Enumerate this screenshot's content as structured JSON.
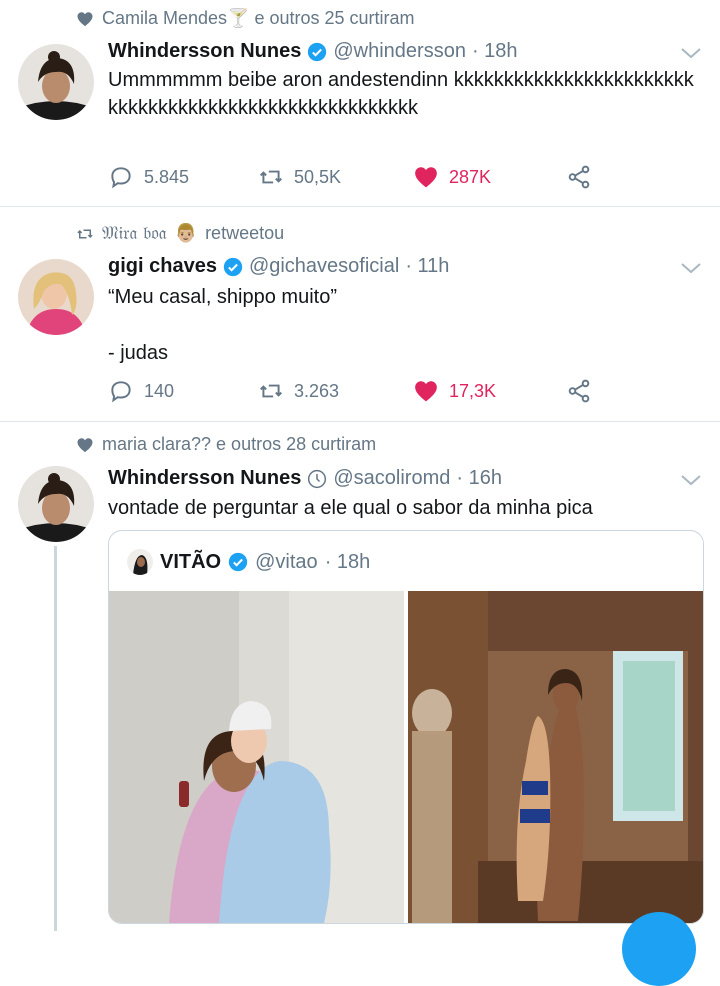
{
  "tweets": [
    {
      "context": "Camila Mendes🍸 e outros 25 curtiram",
      "name": "Whindersson Nunes",
      "handle": "@whindersson",
      "time": "· 18h",
      "text": "Ummmmmm beibe aron andestendinn kkkkkkkkkkkkkkkkkkkkkkkkkkkkkkkkkkkkkkkkkkkkkkkkkkkkkkk",
      "replies": "5.845",
      "retweets": "50,5K",
      "likes": "287K"
    },
    {
      "context_name": "𝔐𝔦𝔯𝔞 𝔟𝔬𝔞",
      "context_emoji": "👨🏼",
      "context_suffix": "retweetou",
      "name": "gigi chaves",
      "handle": "@gichavesoficial",
      "time": "· 11h",
      "text": "“Meu casal, shippo muito”\n\n- judas",
      "replies": "140",
      "retweets": "3.263",
      "likes": "17,3K"
    },
    {
      "context": "maria clara?? e outros 28 curtiram",
      "name": "Whindersson Nunes",
      "handle": "@sacoliromd",
      "time": "· 16h",
      "text": "vontade de perguntar a ele qual o sabor da minha pica",
      "quote": {
        "name": "VITÃO",
        "handle": "@vitao",
        "time": "· 18h"
      }
    }
  ],
  "colors": {
    "accent": "#1da1f2",
    "like": "#e0245e",
    "secondary_text": "#657786",
    "divider": "#e1e8ed"
  }
}
